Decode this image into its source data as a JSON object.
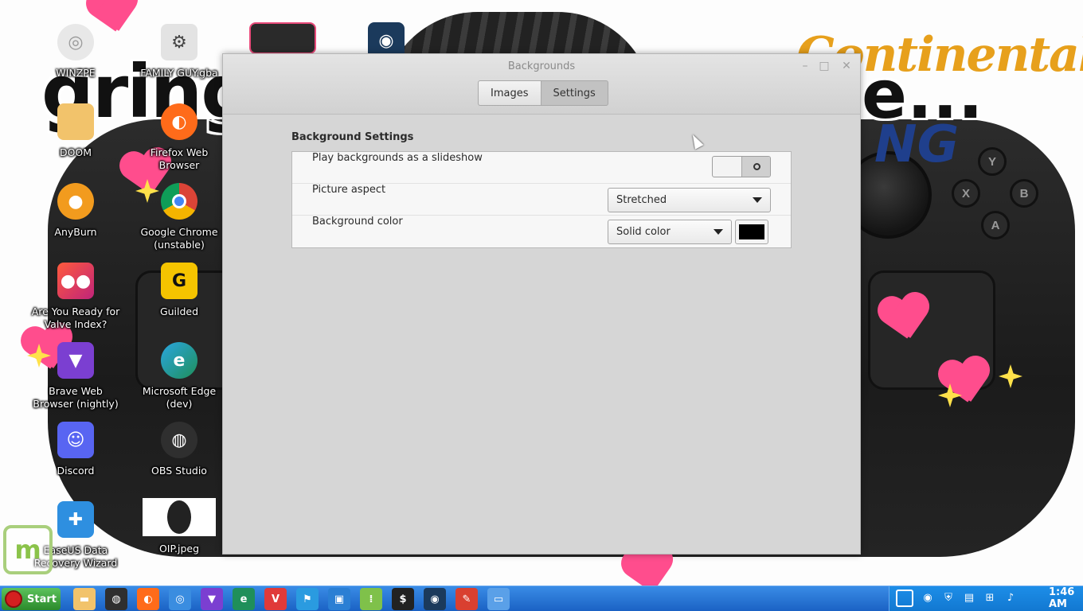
{
  "window": {
    "title": "Backgrounds",
    "tabs": [
      {
        "label": "Images",
        "active": false
      },
      {
        "label": "Settings",
        "active": true
      }
    ],
    "section_title": "Background Settings",
    "rows": {
      "slideshow": {
        "label": "Play backgrounds as a slideshow",
        "toggle_state": "off"
      },
      "aspect": {
        "label": "Picture aspect",
        "value": "Stretched"
      },
      "color": {
        "label": "Background color",
        "value": "Solid color",
        "swatch": "#000000"
      }
    }
  },
  "desktop_icons": [
    {
      "label": "WINZPE",
      "icon": "disc-icon",
      "color": "#e8e8e8"
    },
    {
      "label": "FAMILY GUY.gba",
      "icon": "gear-icon",
      "color": "#e3e3e3"
    },
    {
      "label": "DOOM",
      "icon": "folder-icon",
      "color": "#f2c36b"
    },
    {
      "label": "Firefox Web\nBrowser",
      "icon": "firefox-icon",
      "color": "#ff6b1a"
    },
    {
      "label": "AnyBurn",
      "icon": "anyburn-icon",
      "color": "#f29b1e"
    },
    {
      "label": "Google Chrome\n(unstable)",
      "icon": "chrome-icon",
      "color": "#3a8de0"
    },
    {
      "label": "Are You Ready for\nValve Index?",
      "icon": "index-icon",
      "color": "#e2345c"
    },
    {
      "label": "Guilded",
      "icon": "guilded-icon",
      "color": "#f5c400"
    },
    {
      "label": "Brave Web\nBrowser (nightly)",
      "icon": "brave-icon",
      "color": "#7b3fd1"
    },
    {
      "label": "Microsoft Edge\n(dev)",
      "icon": "edge-icon",
      "color": "#1f8f5a"
    },
    {
      "label": "Discord",
      "icon": "discord-icon",
      "color": "#5865f2"
    },
    {
      "label": "OBS Studio",
      "icon": "obs-icon",
      "color": "#2f2f2f"
    },
    {
      "label": "EaseUS Data\nRecovery Wizard",
      "icon": "easeus-icon",
      "color": "#2e8fe0"
    },
    {
      "label": "OIP.jpeg",
      "icon": "image-file-icon",
      "color": "#ffffff"
    }
  ],
  "wallpaper": {
    "text_left": "gringy",
    "text_right": "e...",
    "brand_top": "Continental",
    "brand_bottom": "NG",
    "buttons": [
      "Y",
      "X",
      "B",
      "A"
    ]
  },
  "taskbar": {
    "start_label": "Start",
    "apps": [
      {
        "icon": "folder-icon",
        "color": "#f2c36b"
      },
      {
        "icon": "obs-icon",
        "color": "#2f2f2f"
      },
      {
        "icon": "firefox-icon",
        "color": "#ff6b1a"
      },
      {
        "icon": "chrome-icon",
        "color": "#3a8de0"
      },
      {
        "icon": "brave-icon",
        "color": "#7b3fd1"
      },
      {
        "icon": "edge-icon",
        "color": "#1f8f5a"
      },
      {
        "icon": "vivaldi-icon",
        "color": "#e03a3a"
      },
      {
        "icon": "flag-icon",
        "color": "#2a9be0"
      },
      {
        "icon": "monitor-icon",
        "color": "#2a7fd4"
      },
      {
        "icon": "grid-icon",
        "color": "#7fc14a"
      },
      {
        "icon": "terminal-icon",
        "color": "#222222"
      },
      {
        "icon": "steam-icon",
        "color": "#1b3a5c"
      },
      {
        "icon": "gimp-icon",
        "color": "#d94030"
      },
      {
        "icon": "file-icon",
        "color": "#5aa0e8"
      }
    ],
    "tray_icons": [
      "mintupdate-icon",
      "steam-icon",
      "shield-icon",
      "clipboard-icon",
      "network-icon",
      "volume-icon"
    ],
    "clock": "1:46 AM"
  }
}
